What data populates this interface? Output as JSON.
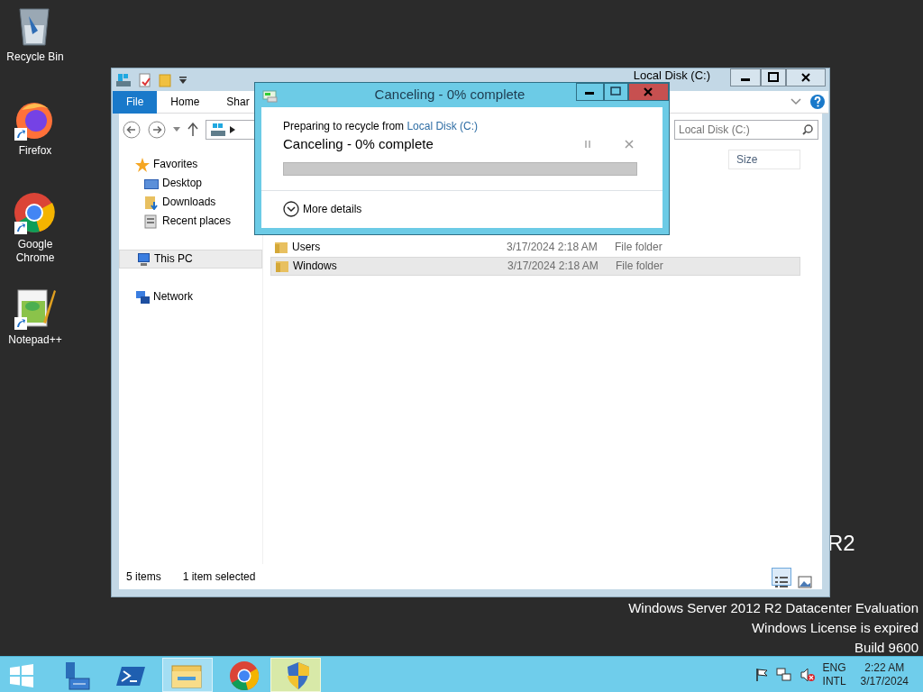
{
  "desktop_icons": [
    {
      "label": "Recycle Bin",
      "kind": "recycle",
      "shortcut": false
    },
    {
      "label": "Firefox",
      "kind": "firefox",
      "shortcut": true
    },
    {
      "label": "Google Chrome",
      "kind": "chrome",
      "shortcut": true
    },
    {
      "label": "Notepad++",
      "kind": "notepad",
      "shortcut": true
    }
  ],
  "watermark": {
    "logo": "R2",
    "lines": [
      "Windows Server 2012 R2 Datacenter Evaluation",
      "Windows License is expired",
      "Build 9600"
    ]
  },
  "explorer": {
    "title": "Local Disk (C:)",
    "ribbon_tabs": [
      {
        "label": "File",
        "selected": true
      },
      {
        "label": "Home",
        "selected": false
      },
      {
        "label": "Shar",
        "selected": false
      }
    ],
    "search": {
      "placeholder": "Local Disk (C:)"
    },
    "nav": [
      {
        "label": "Favorites",
        "kind": "star",
        "selected": false,
        "children": [
          {
            "label": "Desktop",
            "kind": "desktop",
            "selected": false
          },
          {
            "label": "Downloads",
            "kind": "downloads",
            "selected": false
          },
          {
            "label": "Recent places",
            "kind": "recent",
            "selected": false
          }
        ]
      },
      {
        "label": "This PC",
        "kind": "pc",
        "selected": true
      },
      {
        "label": "Network",
        "kind": "network",
        "selected": false
      }
    ],
    "columns": [
      "Size"
    ],
    "rows": [
      {
        "name": "Users",
        "date": "3/17/2024 2:18 AM",
        "type": "File folder",
        "selected": false
      },
      {
        "name": "Windows",
        "date": "3/17/2024 2:18 AM",
        "type": "File folder",
        "selected": true
      }
    ],
    "status": {
      "count": "5 items",
      "selection": "1 item selected"
    },
    "views": [
      {
        "kind": "details",
        "selected": true
      },
      {
        "kind": "thumbnails",
        "selected": false
      }
    ]
  },
  "dialog": {
    "title": "Canceling - 0% complete",
    "message": "Preparing to recycle from",
    "source_link": "Local Disk (C:)",
    "status": "Canceling - 0% complete",
    "level": 0,
    "details": "More details"
  },
  "taskbar": {
    "apps": [
      {
        "kind": "start",
        "selected": false
      },
      {
        "kind": "server",
        "selected": false
      },
      {
        "kind": "powershell",
        "selected": false
      },
      {
        "kind": "explorer",
        "selected": true
      },
      {
        "kind": "chrome",
        "selected": false
      },
      {
        "kind": "shield",
        "selected": true
      }
    ],
    "language": "ENG",
    "layout": "INTL",
    "time": "2:22 AM",
    "date": "3/17/2024"
  }
}
